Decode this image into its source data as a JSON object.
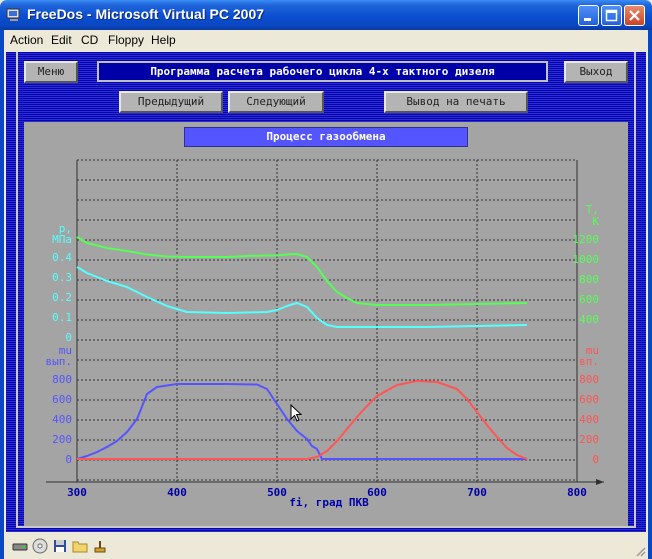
{
  "window": {
    "title": "FreeDos - Microsoft Virtual PC 2007",
    "title_color": "#0b4fd0"
  },
  "menu": {
    "items": [
      {
        "label": "Action"
      },
      {
        "label": "Edit"
      },
      {
        "label": "CD"
      },
      {
        "label": "Floppy"
      },
      {
        "label": "Help"
      }
    ]
  },
  "dos": {
    "menu_button": "Меню",
    "program_title": "Программа расчета рабочего цикла 4-х тактного дизеля",
    "exit_button": "Выход",
    "prev_button": "Предыдущий",
    "next_button": "Следующий",
    "print_button": "Вывод на печать",
    "panel_title": "Процесс газообмена"
  },
  "status_icons": [
    "hdd-icon",
    "cd-icon",
    "floppy-icon",
    "folder-icon",
    "network-icon"
  ],
  "chart_data": {
    "type": "line",
    "xlabel": "fi, град ПКВ",
    "x_ticks": [
      300,
      400,
      500,
      600,
      700,
      800
    ],
    "xlim": [
      300,
      800
    ],
    "axes": {
      "pressure": {
        "label_line1": "p,",
        "label_line2": "МПа",
        "ticks": [
          "0.4",
          "0.3",
          "0.2",
          "0.1",
          "0"
        ],
        "range": [
          0,
          0.4
        ],
        "color": "#55ffff"
      },
      "temperature": {
        "label_line1": "T,",
        "label_line2": "K",
        "ticks": [
          "1200",
          "1000",
          "800",
          "600",
          "400"
        ],
        "range": [
          0,
          1200
        ],
        "color": "#55ff55"
      },
      "mu_exhaust": {
        "label_line1": "mu",
        "label_line2": "вып.",
        "ticks": [
          "800",
          "600",
          "400",
          "200",
          "0"
        ],
        "range": [
          0,
          800
        ],
        "color": "#5555ff"
      },
      "mu_intake": {
        "label_line1": "mu",
        "label_line2": "вп.",
        "ticks": [
          "800",
          "600",
          "400",
          "200",
          "0"
        ],
        "range": [
          0,
          800
        ],
        "color": "#ff5555"
      }
    },
    "series": [
      {
        "axis": "temperature",
        "color": "#55ff55",
        "x": [
          300,
          310,
          330,
          350,
          370,
          390,
          410,
          430,
          450,
          470,
          490,
          500,
          510,
          520,
          530,
          540,
          550,
          560,
          570,
          580,
          600,
          650,
          700,
          750
        ],
        "y": [
          1000,
          940,
          890,
          860,
          825,
          805,
          800,
          800,
          800,
          810,
          815,
          815,
          825,
          830,
          800,
          700,
          560,
          450,
          390,
          340,
          320,
          320,
          330,
          340
        ]
      },
      {
        "axis": "pressure",
        "color": "#55ffff",
        "x": [
          300,
          310,
          330,
          350,
          370,
          390,
          410,
          450,
          490,
          500,
          510,
          520,
          530,
          540,
          550,
          560,
          570,
          600,
          650,
          700,
          750
        ],
        "y": [
          0.35,
          0.32,
          0.28,
          0.25,
          0.2,
          0.155,
          0.125,
          0.12,
          0.125,
          0.135,
          0.155,
          0.17,
          0.15,
          0.095,
          0.06,
          0.05,
          0.05,
          0.05,
          0.05,
          0.055,
          0.06
        ]
      },
      {
        "axis": "mu_exhaust",
        "color": "#5555ff",
        "x": [
          300,
          310,
          320,
          330,
          340,
          350,
          360,
          370,
          380,
          400,
          450,
          480,
          490,
          500,
          510,
          520,
          530,
          535,
          540,
          545,
          560,
          600,
          700,
          750
        ],
        "y": [
          0,
          30,
          70,
          120,
          180,
          270,
          400,
          650,
          720,
          750,
          750,
          745,
          700,
          550,
          400,
          280,
          200,
          130,
          100,
          0,
          0,
          0,
          0,
          0
        ]
      },
      {
        "axis": "mu_intake",
        "color": "#ff5555",
        "x": [
          300,
          400,
          500,
          520,
          530,
          540,
          550,
          560,
          570,
          580,
          590,
          600,
          620,
          640,
          660,
          680,
          690,
          700,
          710,
          720,
          730,
          740,
          750
        ],
        "y": [
          0,
          0,
          0,
          0,
          0,
          20,
          80,
          180,
          300,
          420,
          530,
          630,
          740,
          780,
          770,
          700,
          600,
          470,
          340,
          220,
          110,
          40,
          0
        ]
      }
    ]
  }
}
